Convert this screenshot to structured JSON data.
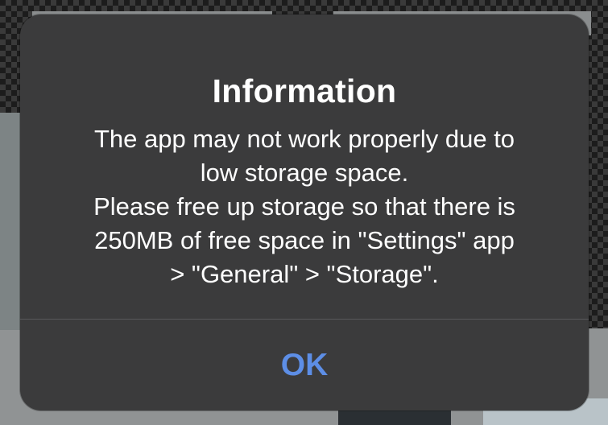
{
  "alert": {
    "title": "Information",
    "message_lines": [
      "The app may not work properly due to",
      "low storage space.",
      "Please free up storage so that there is",
      "250MB of free space in \"Settings\" app",
      "> \"General\" > \"Storage\"."
    ],
    "ok_label": "OK"
  },
  "colors": {
    "alert_background": "#3b3b3c",
    "text": "#ffffff",
    "button_accent": "#5d8ee6",
    "divider": "#58585a"
  }
}
